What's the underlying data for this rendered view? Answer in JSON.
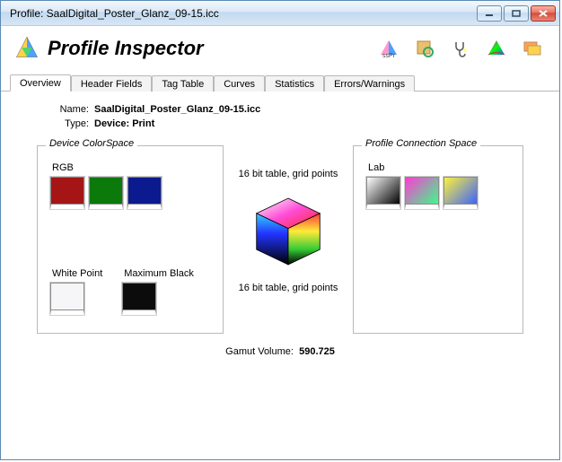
{
  "window": {
    "title": "Profile: SaalDigital_Poster_Glanz_09-15.icc"
  },
  "app": {
    "title": "Profile Inspector"
  },
  "tabs": {
    "items": [
      {
        "label": "Overview",
        "active": true
      },
      {
        "label": "Header Fields",
        "active": false
      },
      {
        "label": "Tag Table",
        "active": false
      },
      {
        "label": "Curves",
        "active": false
      },
      {
        "label": "Statistics",
        "active": false
      },
      {
        "label": "Errors/Warnings",
        "active": false
      }
    ]
  },
  "overview": {
    "name_label": "Name:",
    "name_value": "SaalDigital_Poster_Glanz_09-15.icc",
    "type_label": "Type:",
    "type_value": "Device: Print"
  },
  "device": {
    "group_title": "Device ColorSpace",
    "primary_label": "RGB",
    "whitepoint_label": "White Point",
    "maxblack_label": "Maximum Black"
  },
  "center": {
    "a2b_label": "16 bit table,  grid points",
    "b2a_label": "16 bit table,  grid points"
  },
  "pcs": {
    "group_title": "Profile Connection Space",
    "primary_label": "Lab"
  },
  "footer": {
    "label": "Gamut Volume:",
    "value": "590.725"
  }
}
